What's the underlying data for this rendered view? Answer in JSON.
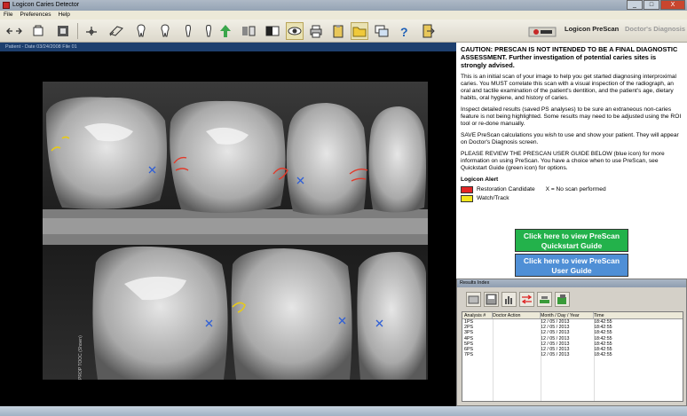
{
  "window": {
    "title": "Logicon Caries Detector",
    "minimize": "_",
    "maximize": "□",
    "close": "X"
  },
  "menu": [
    "File",
    "Preferences",
    "Help"
  ],
  "toolbar": {
    "tools": [
      "arrow-tool",
      "selection-tool",
      "image-mode-tool",
      "tooth-tool",
      "roi-tool",
      "tooth-outline-tool",
      "tooth-outline-tool-2",
      "tooth-outline-tool-3",
      "tooth-outline-tool-4",
      "go-tool",
      "compare-tool",
      "contrast-tool",
      "prescan-tool",
      "print-tool",
      "clipboard-tool",
      "folder-tool",
      "windows-tool",
      "help-tool",
      "exit-tool"
    ],
    "active_tool": "prescan-tool",
    "brand_primary": "Logicon PreScan",
    "brand_secondary": "Doctor's Diagnosis"
  },
  "image_panel": {
    "caption": "Patient - Date 03/24/2008 File 01",
    "watermark": "PROP TOOC (Shown)"
  },
  "info": {
    "caution": "CAUTION: PRESCAN IS NOT INTENDED TO BE A FINAL DIAGNOSTIC ASSESSMENT. Further investigation of potential caries sites is strongly advised.",
    "para1": "This is an initial scan of your image to help you get started diagnosing interproximal caries. You MUST correlate this scan with a visual inspection of the radiograph, an oral and tactile examination of the patient's dentition, and the patient's age, dietary habits, oral hygiene, and history of caries.",
    "para2": "Inspect detailed results (saved PS analyses) to be sure an extraneous non-caries feature is not being highlighted. Some results may need to be adjusted using the ROI tool or re-done manually.",
    "para3": "SAVE PreScan calculations you wish to use and show your patient. They will appear on Doctor's Diagnosis screen.",
    "para4": "PLEASE REVIEW THE PRESCAN USER GUIDE BELOW (blue icon) for more information on using PreScan. You have a choice when to use PreScan, see Quickstart Guide (green icon) for options.",
    "alert_title": "Logicon Alert",
    "legend_red": "Restoration Candidate",
    "legend_x": "X = No scan performed",
    "legend_yellow": "Watch/Track",
    "color_red": "#e32626",
    "color_yellow": "#f2e51c",
    "btn_quickstart": "Click here to view PreScan Quickstart Guide",
    "btn_userguide": "Click here to view PreScan User Guide"
  },
  "results": {
    "title": "Results Index",
    "tools": [
      "open-icon",
      "save-icon",
      "chart-icon",
      "compare-icon",
      "layers-icon",
      "export-icon"
    ],
    "headers": [
      "Analysis #",
      "Doctor Action",
      "Month / Day / Year",
      "Time"
    ],
    "rows": [
      [
        "1PS",
        "",
        "12 / 05 / 2013",
        "18:42:55"
      ],
      [
        "2PS",
        "",
        "12 / 05 / 2013",
        "18:42:55"
      ],
      [
        "3PS",
        "",
        "12 / 05 / 2013",
        "18:42:55"
      ],
      [
        "4PS",
        "",
        "12 / 05 / 2013",
        "18:42:55"
      ],
      [
        "5PS",
        "",
        "12 / 05 / 2013",
        "18:42:55"
      ],
      [
        "6PS",
        "",
        "12 / 05 / 2013",
        "18:42:55"
      ],
      [
        "7PS",
        "",
        "12 / 05 / 2013",
        "18:42:55"
      ]
    ]
  }
}
